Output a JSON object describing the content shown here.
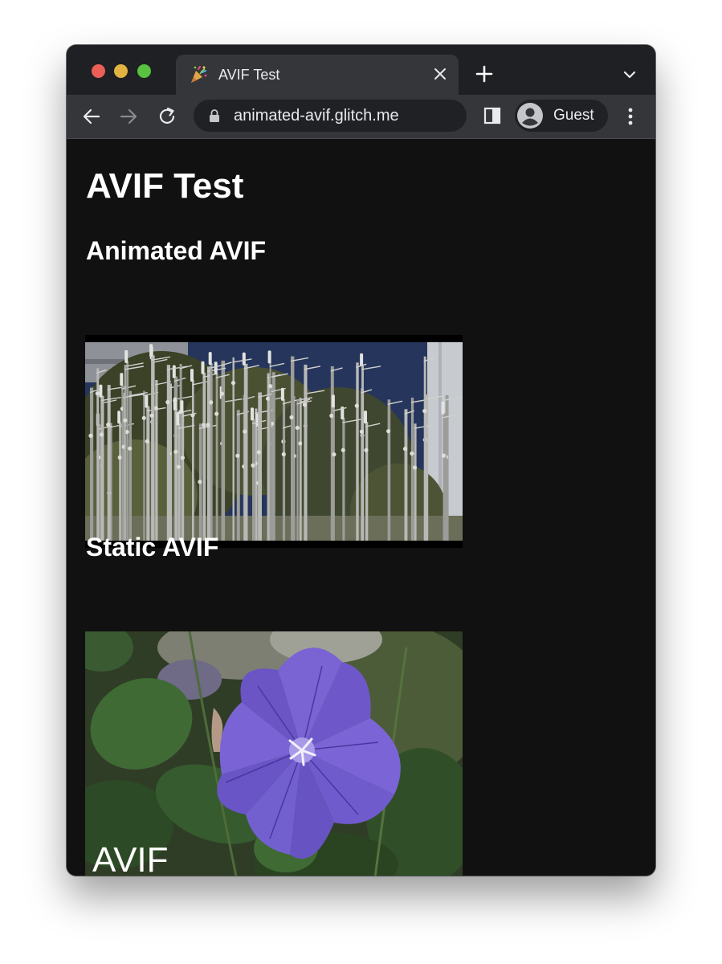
{
  "browser": {
    "tab": {
      "title": "AVIF Test"
    },
    "address_bar": {
      "url": "animated-avif.glitch.me"
    },
    "profile": {
      "label": "Guest"
    }
  },
  "page": {
    "title": "AVIF Test",
    "sections": [
      {
        "heading": "Animated AVIF"
      },
      {
        "heading": "Static AVIF",
        "image_overlay_text": "AVIF"
      }
    ]
  },
  "colors": {
    "tabstrip_bg": "#1f2023",
    "toolbar_bg": "#35363a",
    "page_bg": "#111111",
    "text": "#ffffff"
  },
  "icons": [
    "party-popper-icon",
    "close-icon",
    "plus-icon",
    "chevron-down-icon",
    "back-arrow-icon",
    "forward-arrow-icon",
    "reload-icon",
    "lock-icon",
    "side-panel-icon",
    "account-icon",
    "more-vert-icon"
  ]
}
